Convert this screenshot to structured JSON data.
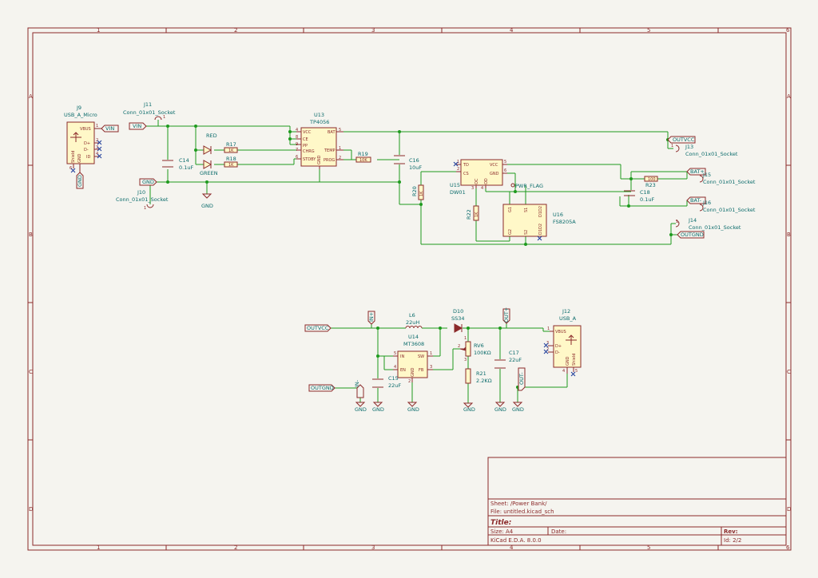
{
  "title_block": {
    "sheet": "Sheet: /Power Bank/",
    "file": "File: untitled.kicad_sch",
    "title": "Title:",
    "size": "Size: A4",
    "date": "Date:",
    "rev": "Rev:",
    "tool": "KiCad E.D.A. 8.0.0",
    "id": "Id: 2/2"
  },
  "zones": {
    "cols": [
      "1",
      "2",
      "3",
      "4",
      "5",
      "6"
    ],
    "rows": [
      "A",
      "B",
      "C",
      "D"
    ]
  },
  "components": {
    "j9": {
      "ref": "J9",
      "val": "USB_A_Micro",
      "pins": [
        "VBUS",
        "D+",
        "D-",
        "ID",
        "GND",
        "Shield"
      ],
      "nums": [
        "1",
        "2",
        "3",
        "4",
        "5",
        "6"
      ]
    },
    "j11": {
      "ref": "J11",
      "val": "Conn_01x01_Socket",
      "pin": "1"
    },
    "j10": {
      "ref": "J10",
      "val": "Conn_01x01_Socket",
      "pin": "1"
    },
    "c14": {
      "ref": "C14",
      "val": "0.1uF"
    },
    "led_red": {
      "val": "RED"
    },
    "led_green": {
      "val": "GREEN"
    },
    "r17": {
      "ref": "R17",
      "val": "1K"
    },
    "r18": {
      "ref": "R18",
      "val": "1K"
    },
    "u13": {
      "ref": "U13",
      "val": "TP4056",
      "pins": [
        "VCC",
        "CE",
        "PP",
        "CHRG",
        "STDBY",
        "BAT",
        "TEMP",
        "PROG",
        "GND"
      ],
      "nums": [
        "4",
        "8",
        "9",
        "7",
        "6",
        "5",
        "1",
        "2",
        "3"
      ]
    },
    "r19": {
      "ref": "R19",
      "val": "10K"
    },
    "c16": {
      "ref": "C16",
      "val": "10uF"
    },
    "r20": {
      "ref": "R20",
      "val": "1K"
    },
    "u15": {
      "ref": "U15",
      "val": "DW01",
      "pins": [
        "TD",
        "CS",
        "VCC",
        "GND",
        "OC",
        "OD"
      ],
      "nums": [
        "1",
        "2",
        "5",
        "6",
        "3",
        "4"
      ]
    },
    "r22": {
      "ref": "R22",
      "val": "1K"
    },
    "u16": {
      "ref": "U16",
      "val": "FS8205A",
      "pins": [
        "G1",
        "S1",
        "D1D2",
        "D1D2",
        "G2",
        "S2"
      ]
    },
    "pwr_flag": {
      "val": "PWR_FLAG"
    },
    "r23": {
      "ref": "R23",
      "val": "100"
    },
    "c18": {
      "ref": "C18",
      "val": "0.1uF"
    },
    "j13": {
      "ref": "J13",
      "val": "Conn_01x01_Socket",
      "pin": "1"
    },
    "j15": {
      "ref": "J15",
      "val": "Conn_01x01_Socket",
      "pin": "1"
    },
    "j16": {
      "ref": "J16",
      "val": "Conn_01x01_Socket",
      "pin": "1"
    },
    "j14": {
      "ref": "J14",
      "val": "Conn_01x01_Socket",
      "pin": "1"
    },
    "l6": {
      "ref": "L6",
      "val": "22uH"
    },
    "u14": {
      "ref": "U14",
      "val": "MT3608",
      "pins": [
        "IN",
        "SW",
        "EN",
        "FB",
        "GND"
      ],
      "nums": [
        "5",
        "1",
        "4",
        "3",
        "2"
      ]
    },
    "c15": {
      "ref": "C15",
      "val": "22uF"
    },
    "d10": {
      "ref": "D10",
      "val": "SS34"
    },
    "rv6": {
      "ref": "RV6",
      "val": "100KΩ",
      "nums": [
        "1",
        "2",
        "3"
      ]
    },
    "r21": {
      "ref": "R21",
      "val": "2.2KΩ"
    },
    "c17": {
      "ref": "C17",
      "val": "22uF"
    },
    "j12": {
      "ref": "J12",
      "val": "USB_A",
      "pins": [
        "VBUS",
        "D+",
        "D-",
        "GND",
        "Shield"
      ],
      "nums": [
        "1",
        "3",
        "2",
        "4",
        "5"
      ]
    }
  },
  "labels": {
    "vin": "VIN",
    "gnd": "GND",
    "outvcc": "OUTVCC",
    "outgnd": "OUTGND",
    "bat_plus": "BAT+",
    "bat_minus": "BAT-",
    "in_plus": "IN+",
    "in_minus": "IN-",
    "out_plus": "OUT+",
    "out_minus": "OUT-"
  }
}
